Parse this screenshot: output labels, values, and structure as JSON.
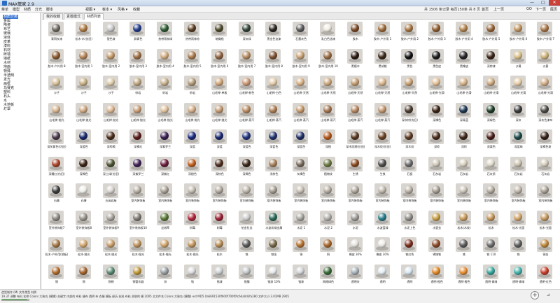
{
  "window": {
    "title": "MAX管家 2.9",
    "minimize": "—",
    "maximize": "□",
    "close": "✕"
  },
  "menu": [
    "菜单",
    "模型",
    "材质",
    "灯光",
    "脚本"
  ],
  "menu_filters": [
    "视图 ▾",
    "板本 ▾",
    "风格 ▾",
    "收藏"
  ],
  "toolbar": {
    "summary": "共 1506 条记录 每页150条 共 8 页",
    "first": "首页",
    "prev": "上一页",
    "page": "6",
    "go": "GO",
    "next": "下一页",
    "last": "尾页"
  },
  "sidebar": {
    "selected_index": 0,
    "categories": [
      "材质分类",
      "金属",
      "陶瓷",
      "布艺",
      "玻璃",
      "液体",
      "皮革",
      "漆料",
      "石材",
      "砖墙",
      "墙纸",
      "木材",
      "地面",
      "特殊",
      "半透明",
      "发光",
      "画框",
      "马赛克",
      "塑料",
      "石头",
      "水",
      "木地板",
      "灯罩"
    ]
  },
  "tabs": [
    {
      "label": "我的收藏",
      "active": false
    },
    {
      "label": "素模模式",
      "active": false
    },
    {
      "label": "材质列表",
      "active": true
    }
  ],
  "materials": [
    {
      "name": "青铜灰漆",
      "color": "#6f6a62"
    },
    {
      "name": "松木·木(仿旧)",
      "color": "#b07c46"
    },
    {
      "name": "银色漆",
      "color": "#c9c9c9"
    },
    {
      "name": "群青色",
      "color": "#243d8a"
    },
    {
      "name": "热带雨林绿",
      "color": "#2f5c33"
    },
    {
      "name": "热带雨林棕",
      "color": "#5a3d22"
    },
    {
      "name": "暗橄榄",
      "color": "#4e4b2c"
    },
    {
      "name": "深灰绿",
      "color": "#334538"
    },
    {
      "name": "黑金色油漆",
      "color": "#2a2520"
    },
    {
      "name": "石墨灰色",
      "color": "#5c5c5c"
    },
    {
      "name": "乳白色油漆",
      "color": "#f1ede4"
    },
    {
      "name": "胶木",
      "color": "#7a4a28"
    },
    {
      "name": "胶木·户外用 1",
      "color": "#9d6b3a"
    },
    {
      "name": "胶木·户外用 2",
      "color": "#a77644"
    },
    {
      "name": "胶木·户外用 3",
      "color": "#8e5e32"
    },
    {
      "name": "胶木·户外用 4",
      "color": "#b38550"
    },
    {
      "name": "胶木·户外用 5",
      "color": "#956539"
    },
    {
      "name": "胶木·户外用 6",
      "color": "#c19562"
    },
    {
      "name": "胶木·户外用 7",
      "color": "#a8774a"
    },
    {
      "name": "胶木·户外用 8",
      "color": "#8b5a30"
    },
    {
      "name": "胶木·室内用 1",
      "color": "#b6875a"
    },
    {
      "name": "胶木·室内用 2",
      "color": "#c4996a"
    },
    {
      "name": "胶木·室内用 3",
      "color": "#9e6f45"
    },
    {
      "name": "胶木·室内用 4",
      "color": "#d3ac80"
    },
    {
      "name": "胶木·室内用 5",
      "color": "#a97b51"
    },
    {
      "name": "胶木·室内用 6",
      "color": "#8f6240"
    },
    {
      "name": "胶木·室内用 7",
      "color": "#b48b60"
    },
    {
      "name": "胶木·室内用 8",
      "color": "#7d5333"
    },
    {
      "name": "胶木·室内用 9",
      "color": "#c9a275"
    },
    {
      "name": "胶木·室内用 10",
      "color": "#9a6c43"
    },
    {
      "name": "黑檀木",
      "color": "#2b1b12"
    },
    {
      "name": "黑胡桃",
      "color": "#3e2a1c"
    },
    {
      "name": "黑色",
      "color": "#111111"
    },
    {
      "name": "黑色皮",
      "color": "#1d1d1d"
    },
    {
      "name": "黑橡皮",
      "color": "#262626"
    },
    {
      "name": "深棕漆",
      "color": "#3a2418"
    },
    {
      "name": "沙黄",
      "color": "#d9c18a"
    },
    {
      "name": "沙黄",
      "color": "#cfb47c"
    },
    {
      "name": "沙子",
      "color": "#d8c29a"
    },
    {
      "name": "沙子",
      "color": "#c9b187"
    },
    {
      "name": "沙子",
      "color": "#e0cfad"
    },
    {
      "name": "砂岩",
      "color": "#bfa783"
    },
    {
      "name": "砂岩",
      "color": "#c8b08e"
    },
    {
      "name": "砂岩",
      "color": "#b29a78"
    },
    {
      "name": "山毛榉·单板",
      "color": "#d2a779"
    },
    {
      "name": "山毛榉·粉色",
      "color": "#cc9877"
    },
    {
      "name": "山毛榉·白色",
      "color": "#e6cda9"
    },
    {
      "name": "山毛榉·天然",
      "color": "#d9b387"
    },
    {
      "name": "山毛榉·天然",
      "color": "#ceaa80"
    },
    {
      "name": "山毛榉·天然",
      "color": "#c49e72"
    },
    {
      "name": "山毛榉·天然",
      "color": "#dbb78e"
    },
    {
      "name": "山毛榉·天然",
      "color": "#c8a176"
    },
    {
      "name": "山毛榉·光滑",
      "color": "#e2c29b"
    },
    {
      "name": "山毛榉·光滑",
      "color": "#d7b58b"
    },
    {
      "name": "山毛榉·光滑",
      "color": "#cda97f"
    },
    {
      "name": "山毛榉·光滑",
      "color": "#e8cfac"
    },
    {
      "name": "山毛榉·光滑",
      "color": "#d4b088"
    },
    {
      "name": "山毛榉·抛光",
      "color": "#d6b58f"
    },
    {
      "name": "山毛榉·抛光",
      "color": "#cfa982"
    },
    {
      "name": "山毛榉·抛光",
      "color": "#deb994"
    },
    {
      "name": "山毛榉·抛光",
      "color": "#c89f78"
    },
    {
      "name": "山毛榉·抛光",
      "color": "#e1c29e"
    },
    {
      "name": "山毛榉·抛光",
      "color": "#d2ad86"
    },
    {
      "name": "山毛榉·抛光",
      "color": "#c39a72"
    },
    {
      "name": "山毛榉·蒸汽",
      "color": "#b98c61"
    },
    {
      "name": "山毛榉·蒸汽",
      "color": "#ad7f55"
    },
    {
      "name": "山毛榉·蒸汽",
      "color": "#c6996d"
    },
    {
      "name": "山毛榉·蒸汽",
      "color": "#a27450"
    },
    {
      "name": "山毛榉·蒸汽",
      "color": "#b58760"
    },
    {
      "name": "山毛榉·蒸汽",
      "color": "#c29770"
    },
    {
      "name": "深灰棕(仿旧)",
      "color": "#4a3b30"
    },
    {
      "name": "深褐色",
      "color": "#3b2316"
    },
    {
      "name": "深青蓝",
      "color": "#1e3a52"
    },
    {
      "name": "深绿色",
      "color": "#1e3d28"
    },
    {
      "name": "深灰",
      "color": "#3a3a3a"
    },
    {
      "name": "深灰色漆布",
      "color": "#4a4a48"
    },
    {
      "name": "深灰紫色(仿旧)",
      "color": "#4b3b4c"
    },
    {
      "name": "深蓝色",
      "color": "#1b2a6b"
    },
    {
      "name": "深棕褐",
      "color": "#4b2c1c"
    },
    {
      "name": "深褐红",
      "color": "#5a1e1a"
    },
    {
      "name": "深紫罗兰",
      "color": "#3a1f52"
    },
    {
      "name": "深蓝",
      "color": "#1d2c7e"
    },
    {
      "name": "深蓝",
      "color": "#1a2870"
    },
    {
      "name": "深蓝色",
      "color": "#22337d"
    },
    {
      "name": "深蓝色",
      "color": "#23346f"
    },
    {
      "name": "深蓝色",
      "color": "#1f2f66"
    },
    {
      "name": "深橙",
      "color": "#b55a1e"
    },
    {
      "name": "深木纹理(仿旧)",
      "color": "#5a3a22"
    },
    {
      "name": "深木纹(仿旧)",
      "color": "#6b4428"
    },
    {
      "name": "深木纹",
      "color": "#5d3b24"
    },
    {
      "name": "深棕",
      "color": "#4a2e1c"
    },
    {
      "name": "深棕",
      "color": "#40281a"
    },
    {
      "name": "深栗色",
      "color": "#4a1f1a"
    },
    {
      "name": "深蓝绿",
      "color": "#1c4a4a"
    },
    {
      "name": "深褐色漆",
      "color": "#35231a"
    },
    {
      "name": "深橘红(仿旧)",
      "color": "#a9452a"
    },
    {
      "name": "深褐色",
      "color": "#3d2518"
    },
    {
      "name": "深土绿(仿旧)",
      "color": "#4c5532"
    },
    {
      "name": "深紫罗兰",
      "color": "#3d2255"
    },
    {
      "name": "深紫红",
      "color": "#6a1f3d"
    },
    {
      "name": "深橙色",
      "color": "#c06020"
    },
    {
      "name": "深棕色",
      "color": "#4e3020"
    },
    {
      "name": "深褐色",
      "color": "#3b2719"
    },
    {
      "name": "浅棕色",
      "color": "#a8825d"
    },
    {
      "name": "灰褐色",
      "color": "#7a6c5d"
    },
    {
      "name": "植物纹",
      "color": "#6b7a45"
    },
    {
      "name": "生锈",
      "color": "#8a4a22"
    },
    {
      "name": "生铁",
      "color": "#4e4e4e"
    },
    {
      "name": "石板",
      "color": "#6c6c6c"
    },
    {
      "name": "石灰岩",
      "color": "#cfc8b8"
    },
    {
      "name": "石灰岩",
      "color": "#d8d1c0"
    },
    {
      "name": "石灰质",
      "color": "#e1dccd"
    },
    {
      "name": "石灰岩",
      "color": "#cbc3b0"
    },
    {
      "name": "石灰岩",
      "color": "#d4ccbb"
    },
    {
      "name": "石墨",
      "color": "#3e3e3e"
    },
    {
      "name": "石膏",
      "color": "#eeeeea"
    },
    {
      "name": "石英岩板",
      "color": "#d9d7d2"
    },
    {
      "name": "室内装饰板",
      "color": "#b8b0a5"
    },
    {
      "name": "室内装饰板",
      "color": "#a9a196"
    },
    {
      "name": "室内装饰板",
      "color": "#c4bdb2"
    },
    {
      "name": "室内装饰板",
      "color": "#b1a99e"
    },
    {
      "name": "室内装饰板",
      "color": "#bdb5aa"
    },
    {
      "name": "室内装饰板",
      "color": "#a69e93"
    },
    {
      "name": "室内装饰板",
      "color": "#c9c2b7"
    },
    {
      "name": "室内装饰板",
      "color": "#b5ada2"
    },
    {
      "name": "室内装饰板",
      "color": "#aea69b"
    },
    {
      "name": "室内装饰板",
      "color": "#c1b9ae"
    },
    {
      "name": "室内装饰板",
      "color": "#b9b1a6"
    },
    {
      "name": "室内装饰板",
      "color": "#a59d92"
    },
    {
      "name": "室内装饰板",
      "color": "#ccc5ba"
    },
    {
      "name": "室内装饰板",
      "color": "#b3ab9f"
    },
    {
      "name": "室内装饰板",
      "color": "#bfb7ac"
    },
    {
      "name": "室内装饰板",
      "color": "#a9a195"
    },
    {
      "name": "室外装饰板7",
      "color": "#8d8a83"
    },
    {
      "name": "室外装饰板8",
      "color": "#9b968e"
    },
    {
      "name": "室外装饰板9",
      "color": "#a7a29a"
    },
    {
      "name": "室外装饰板10",
      "color": "#7f7b74"
    },
    {
      "name": "丝绒草",
      "color": "#5b7a3a"
    },
    {
      "name": "树莓",
      "color": "#b0283d"
    },
    {
      "name": "树莓",
      "color": "#9a2236"
    },
    {
      "name": "铂金拉丝",
      "color": "#cfcfcf"
    },
    {
      "name": "水波状绿金属",
      "color": "#2e6a5a"
    },
    {
      "name": "水泥 1",
      "color": "#a8a6a1"
    },
    {
      "name": "水泥 2",
      "color": "#b3b1ac"
    },
    {
      "name": "水泥",
      "color": "#9e9c97"
    },
    {
      "name": "水波蓝绿",
      "color": "#2b7d8c"
    },
    {
      "name": "水泥上色",
      "color": "#8f8d88"
    },
    {
      "name": "水壶金",
      "color": "#c9a14a"
    },
    {
      "name": "松木(木纹)",
      "color": "#c99c60"
    },
    {
      "name": "松木",
      "color": "#c4955a"
    },
    {
      "name": "松木·光面",
      "color": "#d1a56c"
    },
    {
      "name": "松木·光面",
      "color": "#c69a62"
    },
    {
      "name": "松木·户外用(地板)",
      "color": "#a57a4a"
    },
    {
      "name": "松木·抛光",
      "color": "#d6ab74"
    },
    {
      "name": "松木·抛光",
      "color": "#caa06b"
    },
    {
      "name": "松木·抛光",
      "color": "#bf955f"
    },
    {
      "name": "松木·抛光",
      "color": "#d0a66f"
    },
    {
      "name": "松木·抛光",
      "color": "#c39861"
    },
    {
      "name": "松木",
      "color": "#b88d58"
    },
    {
      "name": "铁",
      "color": "#5a5a5a"
    },
    {
      "name": "铁金",
      "color": "#7a6a4a"
    },
    {
      "name": "铜",
      "color": "#b87333"
    },
    {
      "name": "铜",
      "color": "#a8682e"
    },
    {
      "name": "橡皮 30%",
      "color": "#e6e4df"
    },
    {
      "name": "橡皮 30%",
      "color": "#ecebe6"
    },
    {
      "name": "铁红色",
      "color": "#7a2e20"
    },
    {
      "name": "锈蚀铁",
      "color": "#8a4b2a"
    },
    {
      "name": "铁",
      "color": "#5c5c5c"
    },
    {
      "name": "铁 110",
      "color": "#6e6e6e"
    },
    {
      "name": "铁",
      "color": "#616161"
    },
    {
      "name": "铜金",
      "color": "#c08a3e"
    },
    {
      "name": "铜",
      "color": "#b06d30"
    },
    {
      "name": "铜",
      "color": "#a46530"
    },
    {
      "name": "铜锈",
      "color": "#5d8a74"
    },
    {
      "name": "铜管乐器",
      "color": "#c39a3c"
    },
    {
      "name": "锌",
      "color": "#9aa0a3"
    },
    {
      "name": "铬",
      "color": "#dcdcdc"
    },
    {
      "name": "铬漆",
      "color": "#cfd2d4"
    },
    {
      "name": "铬镍",
      "color": "#c3c6c9"
    },
    {
      "name": "铬漆 10%",
      "color": "#e6e8ea"
    },
    {
      "name": "铬漆",
      "color": "#d4d6d8"
    },
    {
      "name": "网格绿色",
      "color": "#3a6b3a"
    },
    {
      "name": "透明灰",
      "color": "#a9b3bb"
    },
    {
      "name": "透明",
      "color": "#e3eef5"
    },
    {
      "name": "透明",
      "color": "#d9e8f2"
    },
    {
      "name": "透明·橙色",
      "color": "#e08a2e"
    },
    {
      "name": "透明·橙色",
      "color": "#e89038"
    },
    {
      "name": "透明·青绿",
      "color": "#3aa8a0"
    },
    {
      "name": "透明·青绿",
      "color": "#45b3aa"
    },
    {
      "name": "透明·红色",
      "color": "#c8402e"
    }
  ],
  "status": {
    "line1": "造型制作 (M)   文件类型  材质",
    "line2": "19.37   调整 布料   名称 Colors  大致岛 (模糊)   关键字 内部的 布料 缝布 透明 布 衣服 模板 经历 抗料 布料 关联的 模 2005   主文件名 Colors 大致岛 (模糊)   ext   MD5 0a6691530f600f700f0fc6da0d3fa280   文件大小:3.01MB  2905",
    "progress": 0.95
  },
  "footer": {
    "add": "+",
    "corner": "⊿"
  }
}
